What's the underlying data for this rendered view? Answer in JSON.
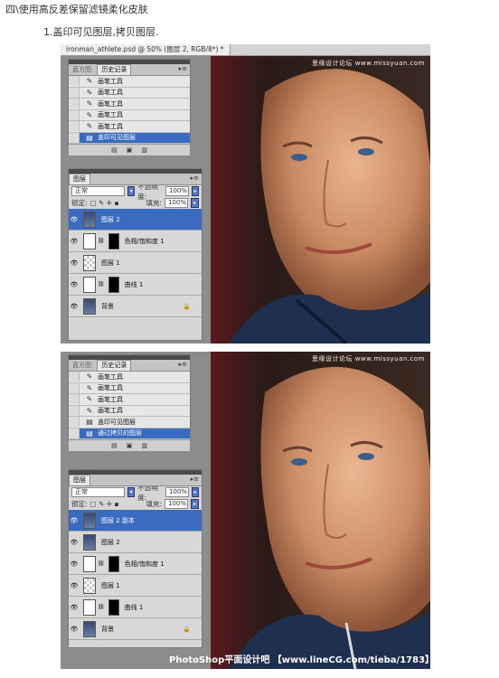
{
  "heading": "四\\使用高反差保留滤镜柔化皮肤",
  "step": "1.盖印可见图层,拷贝图层.",
  "shot1": {
    "doc_tab": "ironman_athlete.psd @ 50% (图层 2, RGB/8*) *",
    "watermark": "思缘设计论坛 www.missyuan.com",
    "history": {
      "tabs": [
        "直方图",
        "历史记录"
      ],
      "rows": [
        "画笔工具",
        "画笔工具",
        "画笔工具",
        "画笔工具",
        "画笔工具",
        "盖印可见图层"
      ],
      "selected_index": 5
    },
    "layers": {
      "tab": "图层",
      "blend_mode": "正常",
      "opacity_label": "不透明度:",
      "opacity": "100%",
      "lock_label": "锁定:",
      "fill_label": "填充:",
      "fill": "100%",
      "rows": [
        {
          "name": "图层 2",
          "thumb": "face",
          "selected": true
        },
        {
          "name": "色相/饱和度 1",
          "thumb": "adj",
          "mask": true
        },
        {
          "name": "图层 1",
          "thumb": "check"
        },
        {
          "name": "曲线 1",
          "thumb": "adj",
          "mask": true
        },
        {
          "name": "背景",
          "thumb": "face",
          "locked": true
        }
      ]
    }
  },
  "shot2": {
    "watermark": "思缘设计论坛 www.missyuan.com",
    "footer_watermark": "PhotoShop平面设计吧 【www.lineCG.com/tieba/1783】",
    "history": {
      "tabs": [
        "直方图",
        "历史记录"
      ],
      "rows": [
        "画笔工具",
        "画笔工具",
        "画笔工具",
        "画笔工具",
        "盖印可见图层",
        "通过拷贝的图层"
      ],
      "selected_index": 5
    },
    "layers": {
      "tab": "图层",
      "blend_mode": "正常",
      "opacity_label": "不透明度:",
      "opacity": "100%",
      "lock_label": "锁定:",
      "fill_label": "填充:",
      "fill": "100%",
      "rows": [
        {
          "name": "图层 2 副本",
          "thumb": "face",
          "selected": true
        },
        {
          "name": "图层 2",
          "thumb": "face"
        },
        {
          "name": "色相/饱和度 1",
          "thumb": "adj",
          "mask": true
        },
        {
          "name": "图层 1",
          "thumb": "check"
        },
        {
          "name": "曲线 1",
          "thumb": "adj",
          "mask": true
        },
        {
          "name": "背景",
          "thumb": "face",
          "locked": true
        }
      ]
    }
  }
}
